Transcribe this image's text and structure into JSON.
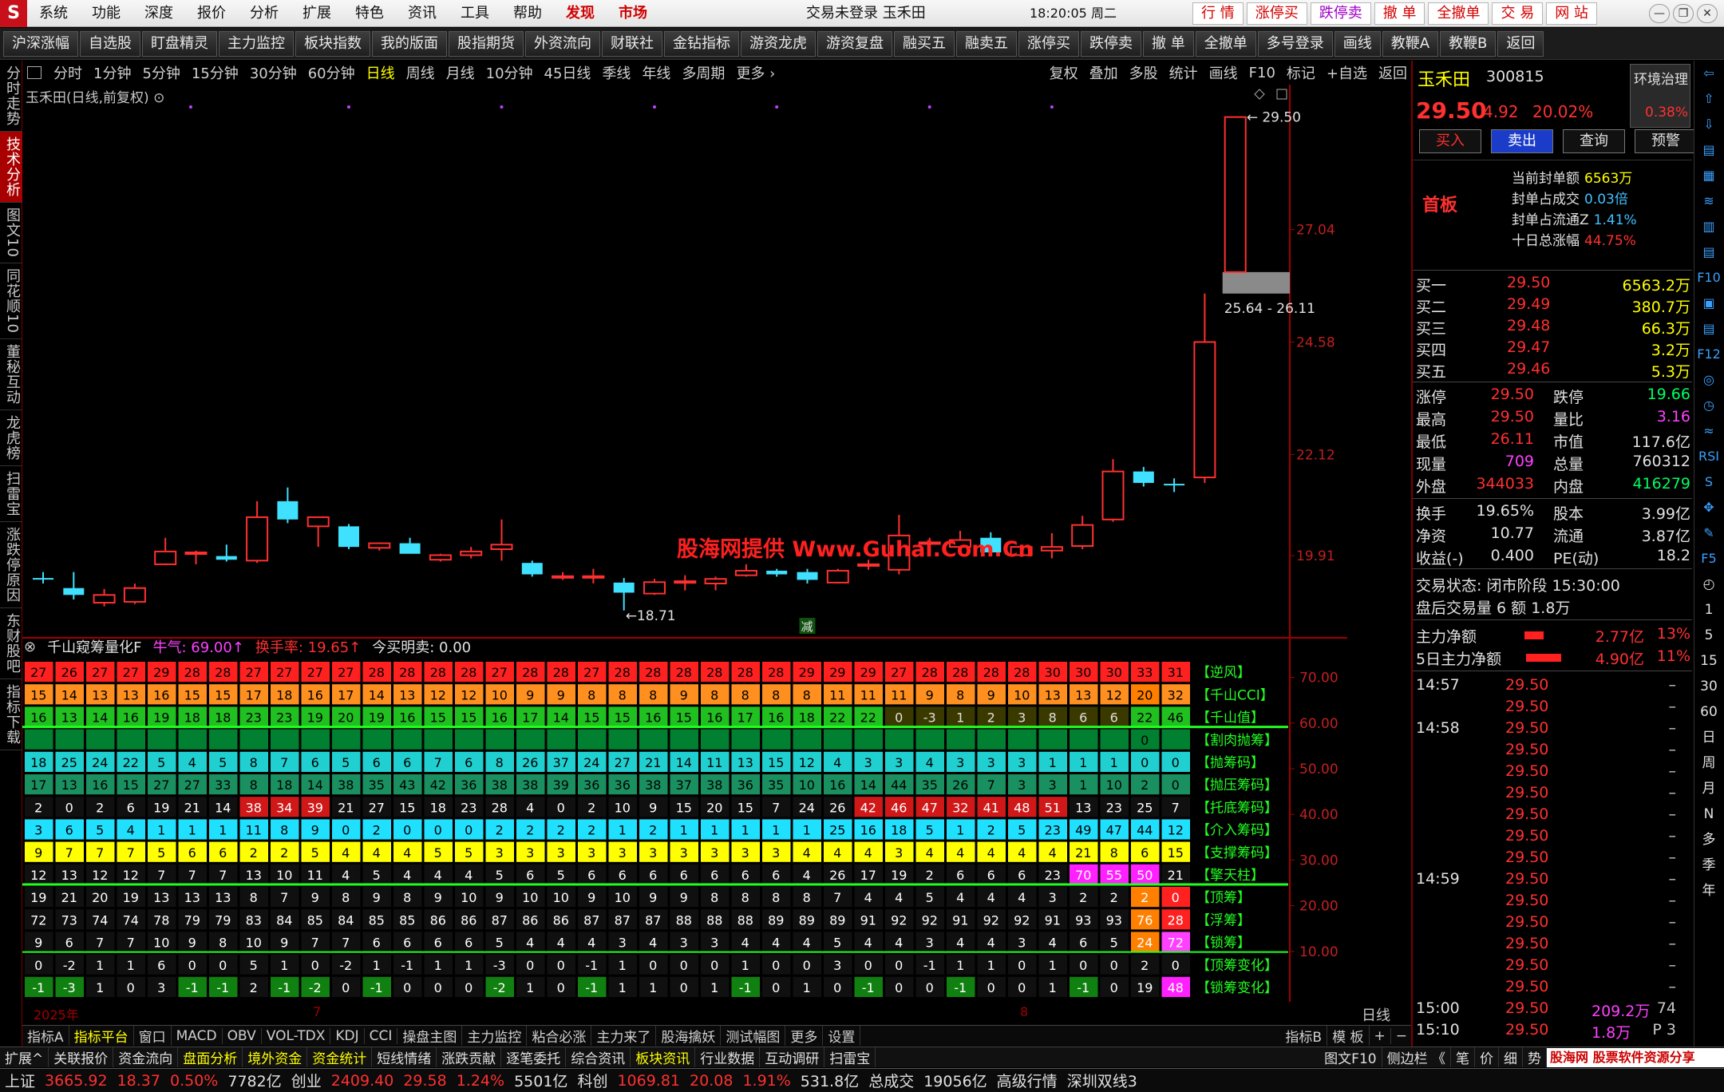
{
  "menubar": {
    "logo": "S",
    "items": [
      "系统",
      "功能",
      "深度",
      "报价",
      "分析",
      "扩展",
      "特色",
      "资讯",
      "工具",
      "帮助"
    ],
    "discover": "发现",
    "market": "市场",
    "title": "交易未登录  玉禾田",
    "time": "18:20:05 周二",
    "trade_buttons": [
      "行 情",
      "涨停买",
      "跌停卖",
      "撤 单",
      "全撤单",
      "交 易",
      "网 站"
    ],
    "win_buttons": [
      "—",
      "❐",
      "✕"
    ]
  },
  "toolbar": [
    "沪深涨幅",
    "自选股",
    "盯盘精灵",
    "主力监控",
    "板块指数",
    "我的版面",
    "股指期货",
    "外资流向",
    "财联社",
    "金钻指标",
    "游资龙虎",
    "游资复盘",
    "融买五",
    "融卖五",
    "涨停买",
    "跌停卖",
    "撤 单",
    "全撤单",
    "多号登录",
    "画线",
    "教鞭A",
    "教鞭B",
    "返回"
  ],
  "leftnav": [
    "分时走势",
    "技术分析",
    "图文10",
    "同花顺10",
    "董秘互动",
    "龙虎榜",
    "扫雷宝",
    "涨跌停原因",
    "东财股吧",
    "指标下载"
  ],
  "periods": [
    "分时",
    "1分钟",
    "5分钟",
    "15分钟",
    "30分钟",
    "60分钟",
    "日线",
    "周线",
    "月线",
    "10分钟",
    "45日线",
    "季线",
    "年线",
    "多周期",
    "更多 ›"
  ],
  "periods_right": [
    "复权",
    "叠加",
    "多股",
    "统计",
    "画线",
    "F10",
    "标记",
    "+自选",
    "返回"
  ],
  "stock_title": "玉禾田(日线,前复权) ⊙",
  "watermark": "股海网提供 Www.Guhai.Com.Cn",
  "price_axis": [
    "29.50",
    "27.04",
    "24.58",
    "22.12",
    "19.91"
  ],
  "price_labels": {
    "high": "29.50",
    "gap": "25.64 - 26.11",
    "low": "18.71",
    "jian": "减"
  },
  "ind_head": {
    "name": "千山窥筹量化F",
    "v1": "牛气: 69.00↑",
    "v2": "换手率: 19.65↑",
    "v3": "今买明卖: 0.00"
  },
  "ind_axis": [
    "70.00",
    "60.00",
    "50.00",
    "40.00",
    "30.00",
    "20.00",
    "10.00"
  ],
  "ind_labels": [
    "【逆风】",
    "【千山CCI】",
    "【千山值】",
    "【割肉抛筹】",
    "【抛筹码】",
    "【抛压筹码】",
    "【托底筹码】",
    "【介入筹码】",
    "【支撑筹码】",
    "【擎天柱】",
    "【顶筹】",
    "【浮筹】",
    "【锁筹】",
    "【顶筹变化】",
    "【锁筹变化】"
  ],
  "date_strip": {
    "year": "2025年",
    "m7": "7",
    "m8": "8"
  },
  "chart_period_label": "日线",
  "tabbar1": [
    "指标A",
    "指标平台",
    "窗口",
    "MACD",
    "OBV",
    "VOL-TDX",
    "KDJ",
    "CCI",
    "操盘主图",
    "主力监控",
    "粘合必涨",
    "主力来了",
    "股海擒妖",
    "测试幅图",
    "更多",
    "设置"
  ],
  "tabbar1_right": [
    "指标B",
    "模 板",
    "+",
    "−"
  ],
  "tabbar2": [
    "扩展^",
    "关联报价",
    "资金流向",
    "盘面分析",
    "境外资金",
    "资金统计",
    "短线情绪",
    "涨跌贡献",
    "逐笔委托",
    "综合资讯",
    "板块资讯",
    "行业数据",
    "互动调研",
    "扫雷宝"
  ],
  "tabbar2_right": [
    "图文F10",
    "侧边栏 《",
    "笔",
    "价",
    "细",
    "势"
  ],
  "guhai": "股海网 股票软件资源分享",
  "statusbar": {
    "sh_label": "上证",
    "sh": "3665.92",
    "sh_chg": "18.37",
    "sh_pct": "0.50%",
    "sh_amt": "7782亿",
    "cy_label": "创业",
    "cy": "2409.40",
    "cy_chg": "29.58",
    "cy_pct": "1.24%",
    "cy_amt": "5501亿",
    "kc_label": "科创",
    "kc": "1069.81",
    "kc_chg": "20.08",
    "kc_pct": "1.91%",
    "kc_amt": "531.8亿",
    "total_label": "总成交",
    "total": "19056亿",
    "adv": "高级行情",
    "site": "深圳双线3"
  },
  "quote": {
    "name": "玉禾田",
    "code": "300815",
    "env": "环境治理",
    "env_pct": "0.38%",
    "price": "29.50",
    "chg": "4.92",
    "pct": "20.02%",
    "buttons": [
      "买入",
      "卖出",
      "查询",
      "预警"
    ],
    "first_board": "首板",
    "seal": [
      {
        "k": "当前封单额",
        "v": "6563万"
      },
      {
        "k": "封单占成交",
        "v": "0.03倍"
      },
      {
        "k": "封单占流通Z",
        "v": "1.41%"
      },
      {
        "k": "十日总涨幅",
        "v": "44.75%"
      }
    ],
    "book": [
      {
        "l": "买一",
        "p": "29.50",
        "v": "6563.2万"
      },
      {
        "l": "买二",
        "p": "29.49",
        "v": "380.7万"
      },
      {
        "l": "买三",
        "p": "29.48",
        "v": "66.3万"
      },
      {
        "l": "买四",
        "p": "29.47",
        "v": "3.2万"
      },
      {
        "l": "买五",
        "p": "29.46",
        "v": "5.3万"
      }
    ],
    "stats": [
      [
        "涨停",
        "29.50",
        "跌停",
        "19.66"
      ],
      [
        "最高",
        "29.50",
        "量比",
        "3.16"
      ],
      [
        "最低",
        "26.11",
        "市值",
        "117.6亿"
      ],
      [
        "现量",
        "709",
        "总量",
        "760312"
      ],
      [
        "外盘",
        "344033",
        "内盘",
        "416279"
      ]
    ],
    "stats2": [
      [
        "换手",
        "19.65%",
        "股本",
        "3.99亿"
      ],
      [
        "净资",
        "10.77",
        "流通",
        "3.87亿"
      ],
      [
        "收益(-)",
        "0.400",
        "PE(动)",
        "18.2"
      ]
    ],
    "trade_state": "交易状态: 闭市阶段 15:30:00",
    "after_hours": "盘后交易量 6 额 1.8万",
    "flow": [
      {
        "k": "主力净额",
        "v": "2.77亿",
        "p": "13%"
      },
      {
        "k": "5日主力净额",
        "v": "4.90亿",
        "p": "11%"
      }
    ],
    "ticks": [
      {
        "t": "14:57",
        "p": "29.50",
        "v": "",
        "d": "–"
      },
      {
        "t": "",
        "p": "29.50",
        "v": "",
        "d": "–"
      },
      {
        "t": "14:58",
        "p": "29.50",
        "v": "",
        "d": "–"
      },
      {
        "t": "",
        "p": "29.50",
        "v": "",
        "d": "–"
      },
      {
        "t": "",
        "p": "29.50",
        "v": "",
        "d": "–"
      },
      {
        "t": "",
        "p": "29.50",
        "v": "",
        "d": "–"
      },
      {
        "t": "",
        "p": "29.50",
        "v": "",
        "d": "–"
      },
      {
        "t": "",
        "p": "29.50",
        "v": "",
        "d": "–"
      },
      {
        "t": "",
        "p": "29.50",
        "v": "",
        "d": "–"
      },
      {
        "t": "14:59",
        "p": "29.50",
        "v": "",
        "d": "–"
      },
      {
        "t": "",
        "p": "29.50",
        "v": "",
        "d": "–"
      },
      {
        "t": "",
        "p": "29.50",
        "v": "",
        "d": "–"
      },
      {
        "t": "",
        "p": "29.50",
        "v": "",
        "d": "–"
      },
      {
        "t": "",
        "p": "29.50",
        "v": "",
        "d": "–"
      },
      {
        "t": "",
        "p": "29.50",
        "v": "",
        "d": "–"
      },
      {
        "t": "15:00",
        "p": "29.50",
        "v": "209.2万",
        "d": "74"
      },
      {
        "t": "15:10",
        "p": "29.50",
        "v": "1.8万",
        "d": "P  3"
      }
    ]
  },
  "rightstrip": [
    "⇦",
    "⇧",
    "⇩",
    "▤",
    "▦",
    "≋",
    "▥",
    "▤",
    "F10",
    "▣",
    "▤",
    "F12",
    "◎",
    "◷",
    "≈",
    "RSI",
    "S",
    "✥",
    "✎",
    "F5",
    "◴",
    "1",
    "5",
    "15",
    "30",
    "60",
    "日",
    "周",
    "月",
    "N",
    "多",
    "季",
    "年"
  ],
  "candles": [
    {
      "o": 19.42,
      "h": 19.55,
      "l": 19.3,
      "c": 19.4
    },
    {
      "o": 19.2,
      "h": 19.55,
      "l": 18.95,
      "c": 19.05
    },
    {
      "o": 18.88,
      "h": 19.18,
      "l": 18.8,
      "c": 19.05
    },
    {
      "o": 18.9,
      "h": 19.3,
      "l": 18.85,
      "c": 19.2
    },
    {
      "o": 19.72,
      "h": 20.3,
      "l": 19.7,
      "c": 20.0
    },
    {
      "o": 19.98,
      "h": 20.02,
      "l": 19.72,
      "c": 19.98
    },
    {
      "o": 19.9,
      "h": 20.15,
      "l": 19.78,
      "c": 19.82
    },
    {
      "o": 19.8,
      "h": 21.1,
      "l": 19.75,
      "c": 20.75
    },
    {
      "o": 21.1,
      "h": 21.4,
      "l": 20.62,
      "c": 20.7
    },
    {
      "o": 20.55,
      "h": 20.7,
      "l": 20.1,
      "c": 20.75
    },
    {
      "o": 20.55,
      "h": 20.6,
      "l": 20.05,
      "c": 20.1
    },
    {
      "o": 20.08,
      "h": 20.2,
      "l": 20.02,
      "c": 20.18
    },
    {
      "o": 20.18,
      "h": 20.3,
      "l": 19.98,
      "c": 19.95
    },
    {
      "o": 19.82,
      "h": 19.95,
      "l": 19.78,
      "c": 19.92
    },
    {
      "o": 19.92,
      "h": 20.1,
      "l": 19.85,
      "c": 20.0
    },
    {
      "o": 20.05,
      "h": 20.7,
      "l": 19.8,
      "c": 20.15
    },
    {
      "o": 19.75,
      "h": 19.8,
      "l": 19.45,
      "c": 19.5
    },
    {
      "o": 19.45,
      "h": 19.55,
      "l": 19.38,
      "c": 19.46
    },
    {
      "o": 19.44,
      "h": 19.62,
      "l": 19.3,
      "c": 19.46
    },
    {
      "o": 19.32,
      "h": 19.42,
      "l": 18.71,
      "c": 19.1
    },
    {
      "o": 19.08,
      "h": 19.4,
      "l": 19.05,
      "c": 19.33
    },
    {
      "o": 19.33,
      "h": 19.48,
      "l": 19.15,
      "c": 19.35
    },
    {
      "o": 19.3,
      "h": 19.45,
      "l": 19.15,
      "c": 19.4
    },
    {
      "o": 19.48,
      "h": 19.72,
      "l": 19.45,
      "c": 19.58
    },
    {
      "o": 19.58,
      "h": 19.62,
      "l": 19.45,
      "c": 19.5
    },
    {
      "o": 19.55,
      "h": 19.62,
      "l": 19.3,
      "c": 19.38
    },
    {
      "o": 19.32,
      "h": 19.62,
      "l": 19.3,
      "c": 19.58
    },
    {
      "o": 19.7,
      "h": 19.82,
      "l": 19.6,
      "c": 19.72
    },
    {
      "o": 19.6,
      "h": 20.8,
      "l": 19.5,
      "c": 20.35
    },
    {
      "o": 20.18,
      "h": 20.3,
      "l": 20.05,
      "c": 20.2
    },
    {
      "o": 20.1,
      "h": 20.45,
      "l": 20.0,
      "c": 20.25
    },
    {
      "o": 20.3,
      "h": 20.42,
      "l": 19.9,
      "c": 19.98
    },
    {
      "o": 19.92,
      "h": 20.15,
      "l": 19.88,
      "c": 20.1
    },
    {
      "o": 20.02,
      "h": 20.4,
      "l": 19.85,
      "c": 20.1
    },
    {
      "o": 20.12,
      "h": 20.78,
      "l": 20.05,
      "c": 20.58
    },
    {
      "o": 20.7,
      "h": 22.02,
      "l": 20.65,
      "c": 21.75
    },
    {
      "o": 21.75,
      "h": 21.85,
      "l": 21.42,
      "c": 21.5
    },
    {
      "o": 21.48,
      "h": 21.6,
      "l": 21.3,
      "c": 21.45
    },
    {
      "o": 21.62,
      "h": 25.64,
      "l": 21.5,
      "c": 24.58
    },
    {
      "o": 26.11,
      "h": 29.5,
      "l": 26.11,
      "c": 29.5
    }
  ],
  "ind_rows": [
    {
      "c": "#ff2020",
      "v": [
        27,
        26,
        27,
        27,
        29,
        28,
        28,
        27,
        27,
        27,
        27,
        28,
        28,
        28,
        28,
        27,
        28,
        28,
        27,
        28,
        28,
        28,
        28,
        28,
        28,
        29,
        29,
        29,
        27,
        28,
        28,
        28,
        28,
        30,
        30,
        30,
        33,
        31
      ]
    },
    {
      "c": "#ff9020",
      "v": [
        15,
        14,
        13,
        13,
        16,
        15,
        15,
        17,
        18,
        16,
        17,
        14,
        13,
        12,
        12,
        10,
        9,
        9,
        8,
        8,
        8,
        9,
        8,
        8,
        8,
        8,
        11,
        11,
        11,
        9,
        8,
        9,
        10,
        13,
        13,
        12,
        20,
        32
      ]
    },
    {
      "c": "#20c020",
      "v": [
        16,
        13,
        14,
        16,
        19,
        18,
        18,
        23,
        23,
        19,
        20,
        19,
        16,
        15,
        15,
        16,
        17,
        14,
        15,
        15,
        16,
        15,
        16,
        17,
        16,
        18,
        22,
        22,
        0,
        -3,
        1,
        2,
        3,
        8,
        6,
        6,
        22,
        46
      ]
    },
    {
      "c": "#808080",
      "v": [
        "",
        "",
        "",
        "",
        "",
        "",
        "",
        "",
        "",
        "",
        "",
        "",
        "",
        "",
        "",
        "",
        "",
        "",
        "",
        "",
        "",
        "",
        "",
        "",
        "",
        "",
        "",
        "",
        "",
        "",
        "",
        "",
        "",
        "",
        "",
        "",
        "0",
        ""
      ]
    },
    {
      "c": "#20d0d0",
      "v": [
        18,
        25,
        24,
        22,
        5,
        4,
        5,
        8,
        7,
        6,
        5,
        6,
        6,
        7,
        6,
        8,
        26,
        37,
        24,
        27,
        21,
        14,
        11,
        13,
        15,
        12,
        4,
        3,
        3,
        4,
        3,
        3,
        3,
        1,
        1,
        1,
        0,
        0
      ]
    },
    {
      "c": "#20a060",
      "v": [
        17,
        13,
        16,
        15,
        27,
        27,
        33,
        8,
        18,
        14,
        38,
        35,
        43,
        42,
        36,
        38,
        38,
        39,
        36,
        36,
        38,
        37,
        38,
        36,
        35,
        10,
        16,
        14,
        44,
        35,
        26,
        7,
        3,
        3,
        1,
        10,
        2,
        0
      ]
    },
    {
      "c": "#ff2020",
      "v": [
        2,
        0,
        2,
        6,
        19,
        21,
        14,
        38,
        34,
        39,
        21,
        27,
        15,
        18,
        23,
        28,
        4,
        0,
        2,
        10,
        9,
        15,
        20,
        15,
        7,
        24,
        26,
        42,
        46,
        47,
        32,
        41,
        48,
        51,
        13,
        23,
        25,
        7
      ]
    },
    {
      "c": "#20e0ff",
      "v": [
        3,
        6,
        5,
        4,
        1,
        1,
        1,
        11,
        8,
        9,
        0,
        2,
        0,
        0,
        0,
        2,
        2,
        2,
        2,
        1,
        2,
        1,
        1,
        1,
        1,
        1,
        25,
        16,
        18,
        5,
        1,
        2,
        5,
        23,
        49,
        47,
        44,
        12
      ]
    },
    {
      "c": "#ffff00",
      "v": [
        9,
        7,
        7,
        7,
        5,
        6,
        6,
        2,
        2,
        5,
        4,
        4,
        4,
        5,
        5,
        3,
        3,
        3,
        3,
        3,
        3,
        3,
        3,
        3,
        3,
        4,
        4,
        4,
        3,
        4,
        4,
        4,
        4,
        4,
        21,
        8,
        6,
        15
      ]
    },
    {
      "c": "#101010",
      "v": [
        12,
        13,
        12,
        12,
        7,
        7,
        7,
        13,
        10,
        11,
        4,
        5,
        4,
        4,
        4,
        5,
        6,
        5,
        6,
        6,
        6,
        6,
        6,
        6,
        6,
        4,
        26,
        17,
        19,
        2,
        6,
        6,
        6,
        23,
        70,
        55,
        50,
        21
      ]
    },
    {
      "c": "#101010",
      "v": [
        19,
        21,
        20,
        19,
        13,
        13,
        13,
        8,
        7,
        9,
        8,
        9,
        8,
        9,
        10,
        9,
        10,
        10,
        9,
        10,
        9,
        9,
        8,
        8,
        8,
        8,
        7,
        4,
        4,
        5,
        4,
        4,
        4,
        3,
        2,
        2,
        2,
        0
      ]
    },
    {
      "c": "#101010",
      "v": [
        72,
        73,
        74,
        74,
        78,
        79,
        79,
        83,
        84,
        85,
        84,
        85,
        85,
        86,
        86,
        87,
        86,
        86,
        87,
        87,
        87,
        88,
        88,
        88,
        89,
        89,
        89,
        91,
        92,
        92,
        91,
        92,
        92,
        91,
        93,
        93,
        76,
        28
      ]
    },
    {
      "c": "#101010",
      "v": [
        9,
        6,
        7,
        7,
        10,
        9,
        8,
        10,
        9,
        7,
        7,
        6,
        6,
        6,
        6,
        5,
        4,
        4,
        4,
        3,
        4,
        3,
        3,
        4,
        4,
        4,
        5,
        4,
        4,
        3,
        4,
        4,
        3,
        4,
        6,
        5,
        24,
        72
      ]
    },
    {
      "c": "#101010",
      "v": [
        0,
        -2,
        1,
        1,
        6,
        0,
        0,
        5,
        1,
        0,
        -2,
        1,
        -1,
        1,
        1,
        -3,
        0,
        0,
        -1,
        1,
        0,
        0,
        0,
        1,
        0,
        0,
        3,
        0,
        0,
        -1,
        1,
        1,
        0,
        1,
        0,
        0,
        2,
        0
      ]
    },
    {
      "c": "#101010",
      "v": [
        -1,
        -3,
        1,
        0,
        3,
        -1,
        -1,
        2,
        -1,
        -2,
        0,
        -1,
        0,
        0,
        0,
        -2,
        1,
        0,
        -1,
        1,
        1,
        0,
        1,
        -1,
        0,
        1,
        0,
        -1,
        0,
        0,
        -1,
        0,
        0,
        1,
        -1,
        0,
        19,
        48
      ]
    }
  ]
}
